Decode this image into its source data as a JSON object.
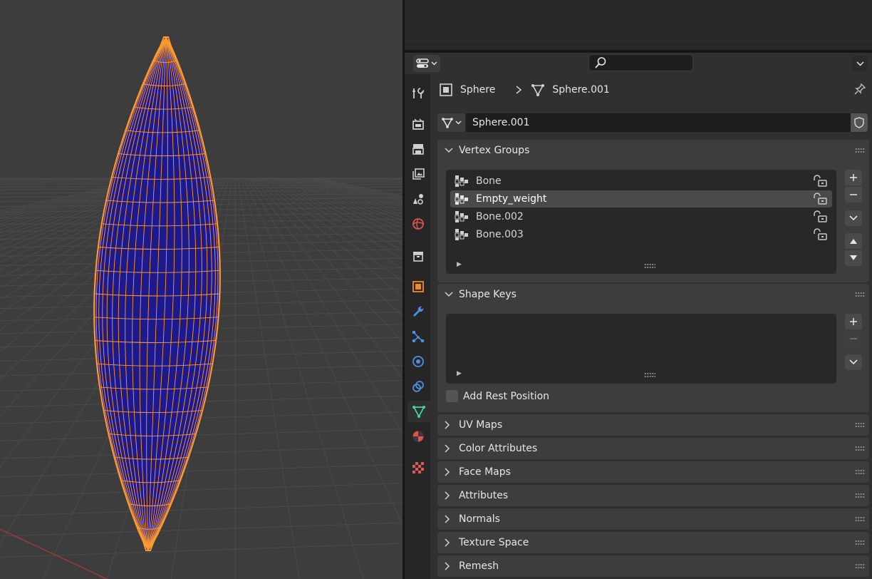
{
  "header": {
    "editor_type_icon": "properties-editor-icon",
    "search_placeholder": ""
  },
  "breadcrumb": {
    "object_name": "Sphere",
    "mesh_name": "Sphere.001"
  },
  "datablock": {
    "name": "Sphere.001"
  },
  "tabs": [
    {
      "name": "tool-tab-icon",
      "active": false
    },
    {
      "name": "render-tab-icon",
      "active": false
    },
    {
      "name": "output-tab-icon",
      "active": false
    },
    {
      "name": "view-layer-tab-icon",
      "active": false
    },
    {
      "name": "scene-tab-icon",
      "active": false
    },
    {
      "name": "world-tab-icon",
      "active": false
    },
    {
      "name": "collection-tab-icon",
      "active": false
    },
    {
      "name": "object-tab-icon",
      "active": false
    },
    {
      "name": "modifiers-tab-icon",
      "active": false
    },
    {
      "name": "particles-tab-icon",
      "active": false
    },
    {
      "name": "physics-tab-icon",
      "active": false
    },
    {
      "name": "constraints-tab-icon",
      "active": false
    },
    {
      "name": "mesh-data-tab-icon",
      "active": true
    },
    {
      "name": "material-tab-icon",
      "active": false
    },
    {
      "name": "texture-tab-icon",
      "active": false
    }
  ],
  "vertex_groups": {
    "title": "Vertex Groups",
    "items": [
      {
        "label": "Bone",
        "selected": false
      },
      {
        "label": "Empty_weight",
        "selected": true
      },
      {
        "label": "Bone.002",
        "selected": false
      },
      {
        "label": "Bone.003",
        "selected": false
      }
    ]
  },
  "shape_keys": {
    "title": "Shape Keys",
    "add_rest_position": "Add Rest Position",
    "add_rest_position_checked": false
  },
  "collapsed_panels": [
    "UV Maps",
    "Color Attributes",
    "Face Maps",
    "Attributes",
    "Normals",
    "Texture Space",
    "Remesh"
  ],
  "colors": {
    "mesh_face": "#1c1a8c",
    "mesh_wire": "#ff9a2e",
    "active_tab_accent": "#3fd6a2"
  }
}
